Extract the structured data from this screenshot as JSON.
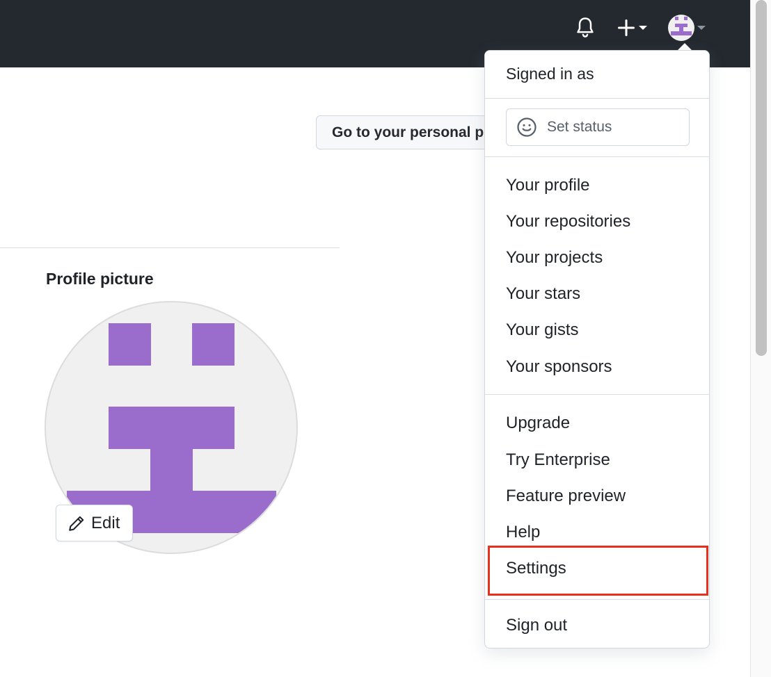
{
  "page": {
    "personal_button_label": "Go to your personal profile",
    "profile_heading": "Profile picture",
    "edit_label": "Edit"
  },
  "dropdown": {
    "signed_in_label": "Signed in as",
    "status_label": "Set status",
    "items_group1": [
      "Your profile",
      "Your repositories",
      "Your projects",
      "Your stars",
      "Your gists",
      "Your sponsors"
    ],
    "items_group2": [
      "Upgrade",
      "Try Enterprise",
      "Feature preview",
      "Help",
      "Settings"
    ],
    "sign_out_label": "Sign out"
  },
  "colors": {
    "header_bg": "#24292f",
    "avatar_purple": "#9a6dcc",
    "highlight": "#e8301c"
  },
  "icons": [
    "bell-icon",
    "plus-icon",
    "caret-down-icon",
    "smiley-icon",
    "pencil-icon"
  ]
}
